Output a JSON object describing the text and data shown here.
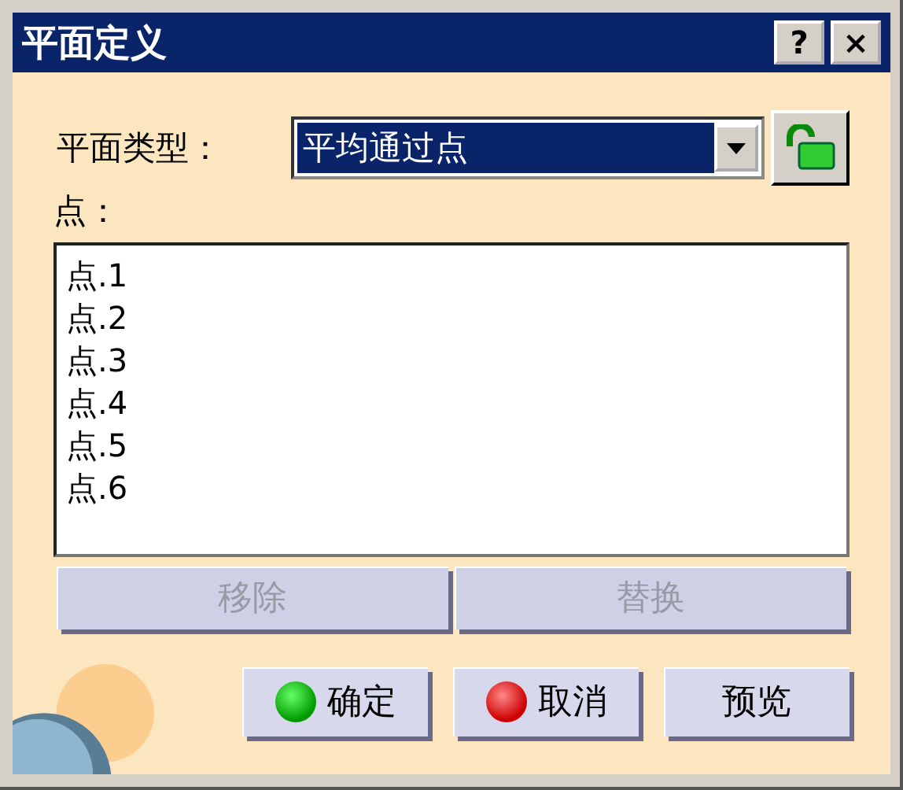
{
  "window": {
    "title": "平面定义",
    "help_button": "?",
    "close_button": "×"
  },
  "plane_type": {
    "label": "平面类型：",
    "value": "平均通过点",
    "selected": true
  },
  "points": {
    "label": "点：",
    "items": [
      "点.1",
      "点.2",
      "点.3",
      "点.4",
      "点.5",
      "点.6"
    ]
  },
  "list_buttons": [
    {
      "label": "移除",
      "disabled": true
    },
    {
      "label": "替换",
      "disabled": true
    }
  ],
  "buttons": [
    {
      "label": "确定",
      "kind": "confirm"
    },
    {
      "label": "取消",
      "kind": "cancel"
    },
    {
      "label": "预览",
      "kind": "plain"
    }
  ]
}
